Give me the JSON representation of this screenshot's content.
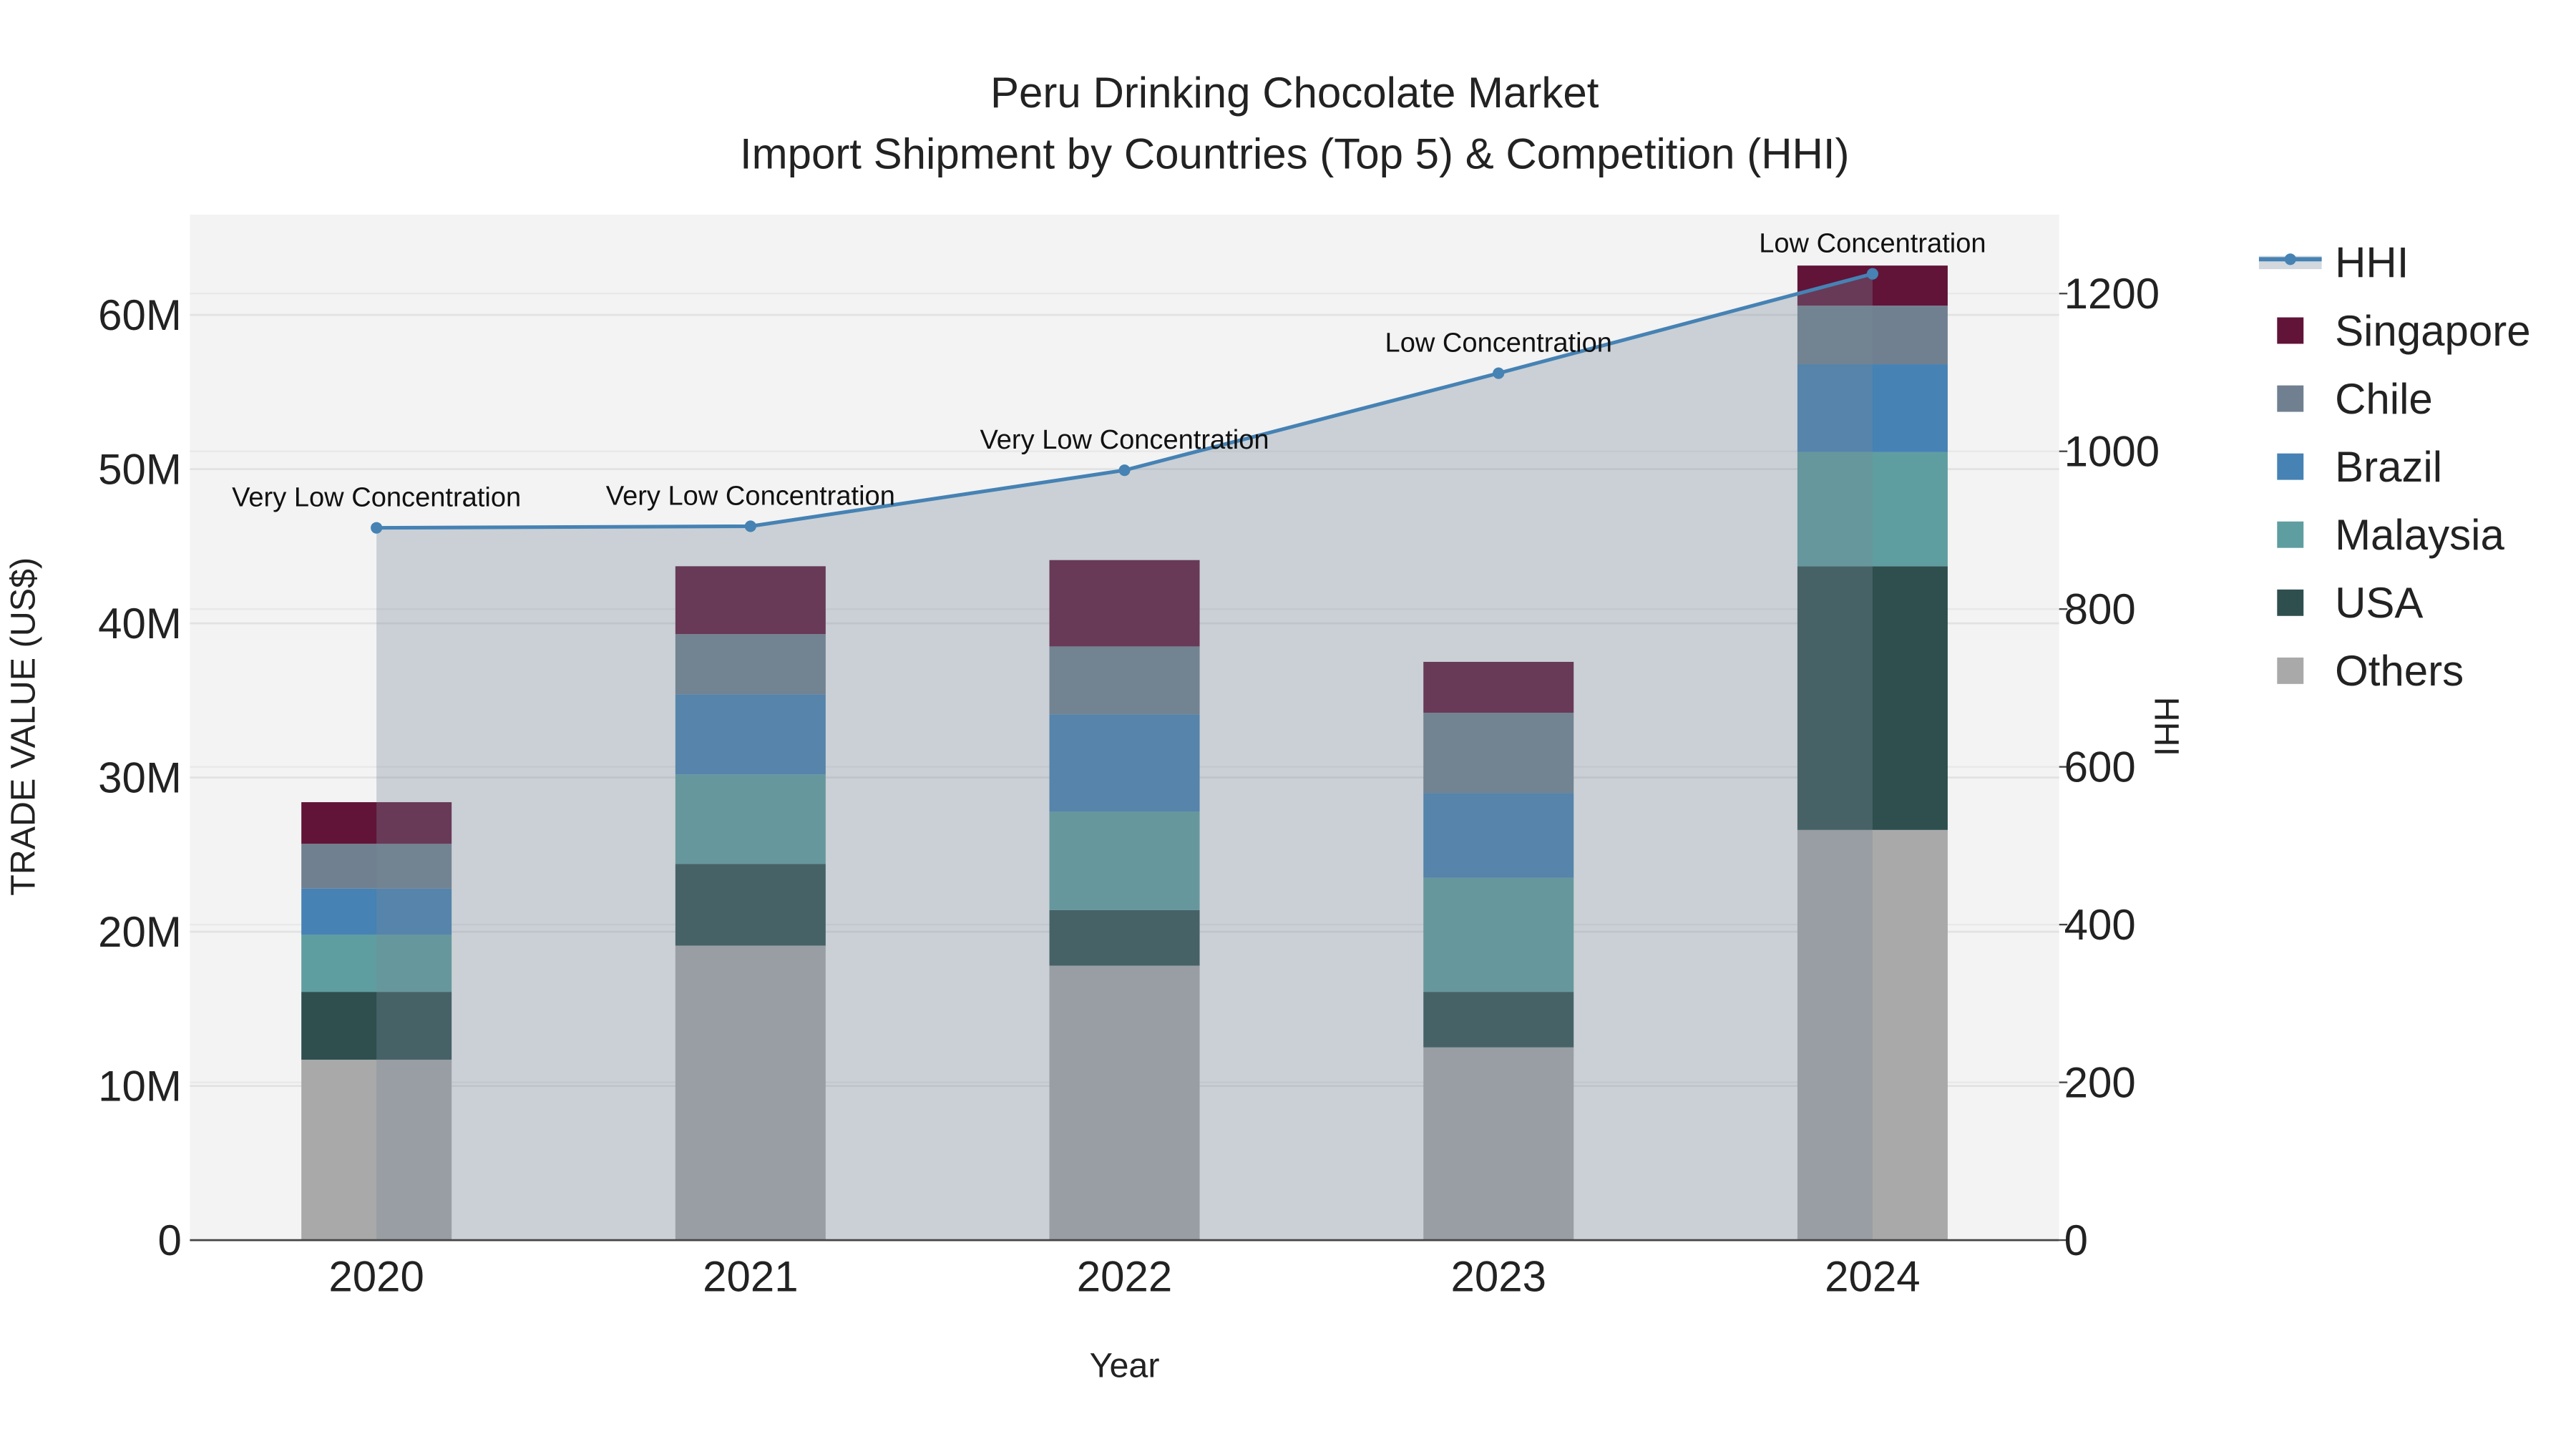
{
  "chart_data": {
    "type": "bar",
    "stacked": true,
    "title": "Peru Drinking Chocolate Market",
    "subtitle": "Import Shipment by Countries (Top 5) & Competition (HHI)",
    "xlabel": "Year",
    "ylabel": "TRADE VALUE (US$)",
    "y2label": "HHI",
    "categories": [
      "2020",
      "2021",
      "2022",
      "2023",
      "2024"
    ],
    "ylim": [
      0,
      66.5
    ],
    "y_unit": "M",
    "y_ticks": [
      0,
      10,
      20,
      30,
      40,
      50,
      60
    ],
    "y_tick_labels": [
      "0",
      "10M",
      "20M",
      "30M",
      "40M",
      "50M",
      "60M"
    ],
    "y2lim": [
      0,
      1300
    ],
    "y2_ticks": [
      0,
      200,
      400,
      600,
      800,
      1000,
      1200
    ],
    "y2_tick_labels": [
      "0",
      "200",
      "400",
      "600",
      "800",
      "1000",
      "1200"
    ],
    "grid": true,
    "legend_placement": "right",
    "series": [
      {
        "name": "Others",
        "color": "#a9a9a9",
        "values": [
          11.7,
          19.1,
          17.8,
          12.5,
          26.6
        ]
      },
      {
        "name": "USA",
        "color": "#2f4f4f",
        "values": [
          4.4,
          5.3,
          3.6,
          3.6,
          17.1
        ]
      },
      {
        "name": "Malaysia",
        "color": "#5f9ea0",
        "values": [
          3.7,
          5.8,
          6.4,
          7.4,
          7.4
        ]
      },
      {
        "name": "Brazil",
        "color": "#4682b4",
        "values": [
          3.0,
          5.2,
          6.3,
          5.5,
          5.7
        ]
      },
      {
        "name": "Chile",
        "color": "#708090",
        "values": [
          2.9,
          3.9,
          4.4,
          5.2,
          3.8
        ]
      },
      {
        "name": "Singapore",
        "color": "#611438",
        "values": [
          2.7,
          4.4,
          5.6,
          3.3,
          2.6
        ]
      }
    ],
    "line_series": {
      "name": "HHI",
      "color": "#4682b4",
      "axis": "y2",
      "values": [
        903,
        905,
        976,
        1099,
        1225
      ],
      "annotations": [
        "Very Low Concentration",
        "Very Low Concentration",
        "Very Low Concentration",
        "Low Concentration",
        "Low Concentration"
      ]
    },
    "legend": [
      "HHI",
      "Singapore",
      "Chile",
      "Brazil",
      "Malaysia",
      "USA",
      "Others"
    ]
  }
}
